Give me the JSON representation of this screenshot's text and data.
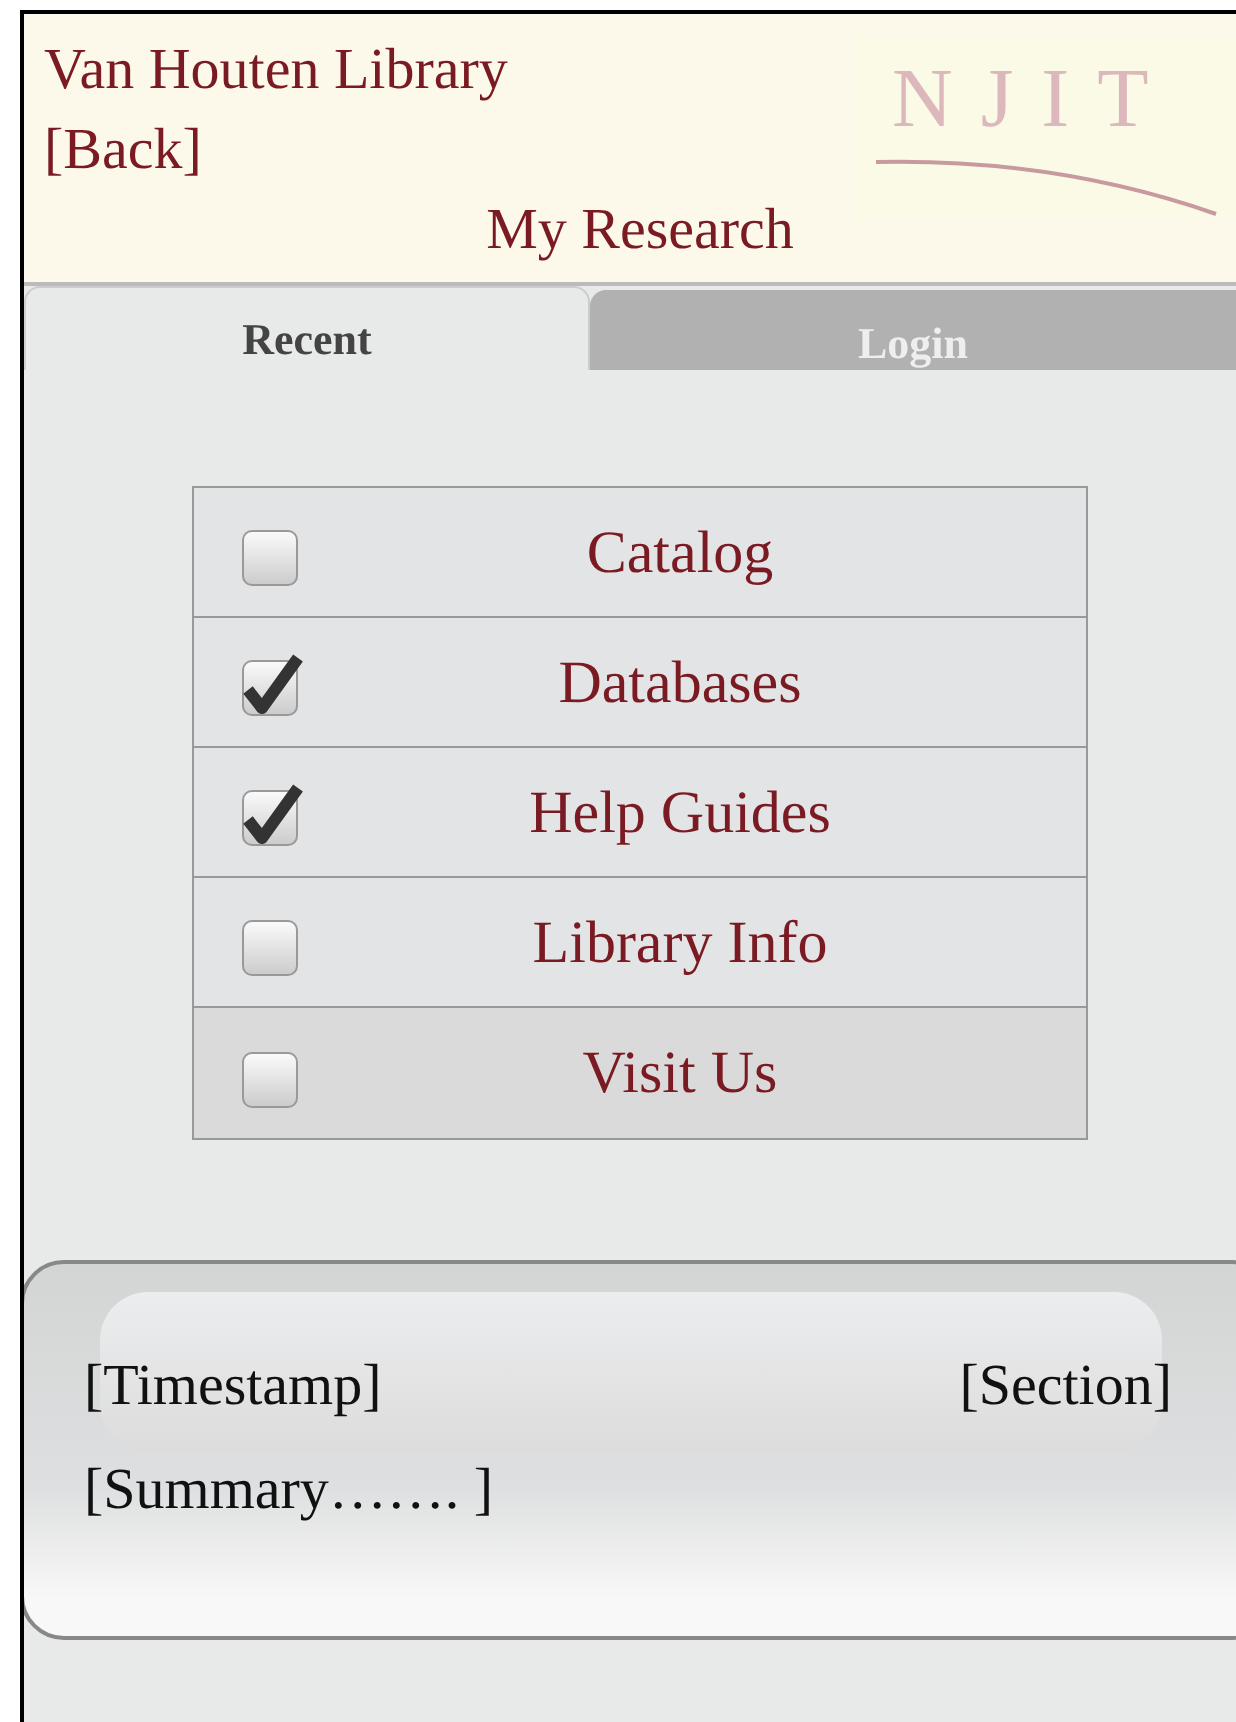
{
  "header": {
    "title": "Van Houten Library",
    "back": "[Back]",
    "logo": "NJIT",
    "page_title": "My Research"
  },
  "tabs": [
    {
      "label": "Recent",
      "selected": true
    },
    {
      "label": "Login",
      "selected": false
    }
  ],
  "items": [
    {
      "label": "Catalog",
      "checked": false
    },
    {
      "label": "Databases",
      "checked": true
    },
    {
      "label": "Help Guides",
      "checked": true
    },
    {
      "label": "Library Info",
      "checked": false
    },
    {
      "label": "Visit Us",
      "checked": false
    }
  ],
  "entry": {
    "timestamp": "[Timestamp]",
    "section": "[Section]",
    "summary": "[Summary……. ]"
  }
}
